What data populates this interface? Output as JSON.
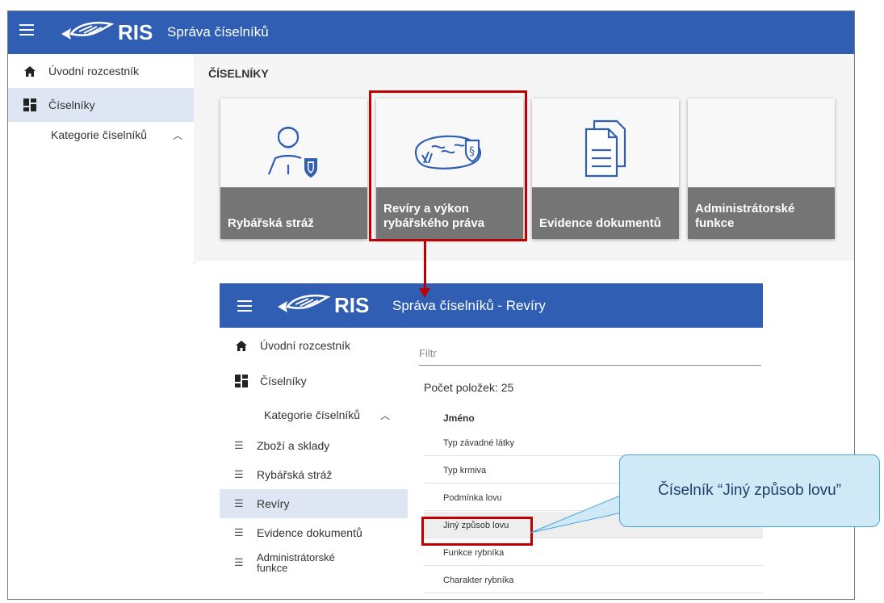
{
  "top": {
    "brand": "RIS",
    "title": "Správa číselníků",
    "nav": [
      {
        "label": "Úvodní rozcestník",
        "icon": "home-icon"
      },
      {
        "label": "Číselníky",
        "icon": "dashboard-icon"
      }
    ],
    "category_label": "Kategorie číselníků",
    "section_title": "ČÍSELNÍKY",
    "tiles": [
      {
        "label": "Rybářská stráž",
        "icon": "fishing-guard-icon"
      },
      {
        "label": "Revíry a výkon rybářského práva",
        "icon": "fishing-waters-icon"
      },
      {
        "label": "Evidence dokumentů",
        "icon": "documents-icon"
      },
      {
        "label": "Administrátorské funkce",
        "icon": ""
      }
    ]
  },
  "inner": {
    "brand": "RIS",
    "title": "Správa číselníků - Revíry",
    "nav": [
      {
        "label": "Úvodní rozcestník",
        "icon": "home-icon"
      },
      {
        "label": "Číselníky",
        "icon": "dashboard-icon"
      }
    ],
    "category_label": "Kategorie číselníků",
    "categories": [
      {
        "label": "Zboží a sklady"
      },
      {
        "label": "Rybářská stráž"
      },
      {
        "label": "Revíry"
      },
      {
        "label": "Evidence dokumentů"
      },
      {
        "label": "Administrátorské funkce"
      }
    ],
    "filter_placeholder": "Filtr",
    "count_text": "Počet položek: 25",
    "column_header": "Jméno",
    "rows": [
      "Typ závadné látky",
      "Typ krmiva",
      "Podmínka lovu",
      "Jiný způsob lovu",
      "Funkce rybníka",
      "Charakter rybníka"
    ]
  },
  "callout": "Číselník “Jiný způsob lovu”",
  "colors": {
    "brand_blue": "#2f5eb3",
    "highlight_red": "#c00000",
    "callout_fill": "#cfe9f7"
  }
}
